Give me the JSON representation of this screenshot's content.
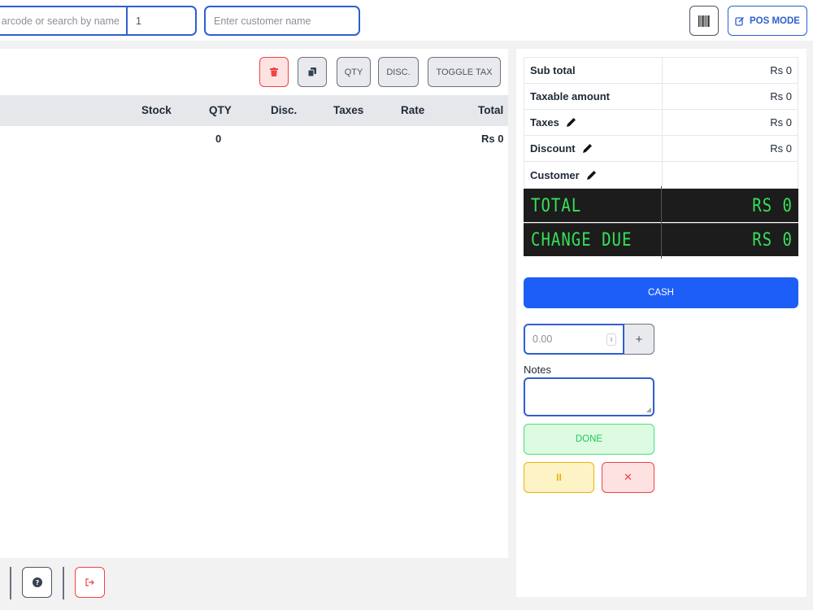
{
  "topbar": {
    "barcode_placeholder": "arcode or search by name",
    "qty_value": "1",
    "customer_placeholder": "Enter customer name",
    "barcode_icon": "barcode-icon",
    "pos_mode_label": "POS MODE",
    "pos_mode_icon": "edit-icon"
  },
  "toolbar": {
    "delete_icon": "trash-icon",
    "copy_icon": "copy-icon",
    "qty_label": "QTY",
    "disc_label": "DISC.",
    "toggle_tax_label": "TOGGLE TAX"
  },
  "table": {
    "columns": [
      "Stock",
      "QTY",
      "Disc.",
      "Taxes",
      "Rate",
      "Total"
    ],
    "rows": [
      {
        "qty": "0",
        "total": "Rs 0"
      }
    ]
  },
  "summary": {
    "subtotal_label": "Sub total",
    "subtotal_value": "Rs 0",
    "taxable_label": "Taxable amount",
    "taxable_value": "Rs 0",
    "taxes_label": "Taxes",
    "taxes_value": "Rs 0",
    "discount_label": "Discount",
    "discount_value": "Rs 0",
    "customer_label": "Customer",
    "customer_value": "",
    "total_label": "TOTAL",
    "total_value": "RS 0",
    "change_label": "CHANGE DUE",
    "change_value": "RS 0"
  },
  "payment": {
    "cash_label": "CASH",
    "amount_placeholder": "0.00",
    "plus_label": "+",
    "notes_label": "Notes",
    "done_label": "DONE",
    "pause_label": "II",
    "cancel_label": "✕"
  },
  "colors": {
    "primary": "#1d5ef6",
    "danger": "#ef4444",
    "success": "#22c55e",
    "warning": "#eab308",
    "lcd_green": "#37e05a"
  }
}
